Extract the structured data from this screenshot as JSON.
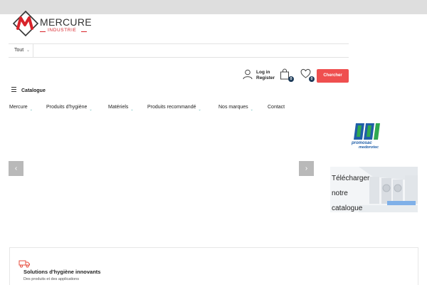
{
  "header": {
    "logo_name": "MERCURE",
    "logo_sub": "INDUSTRIE",
    "account": {
      "login": "Log in",
      "register": "Register"
    },
    "cart_count": "0",
    "wishlist_count": "0",
    "search_button": "Chercher"
  },
  "search": {
    "category": "Tout",
    "value": ""
  },
  "catalogue_label": "Catalogue",
  "nav": {
    "items": [
      {
        "label": "Mercure",
        "has_dropdown": true
      },
      {
        "label": "Produits d'hygiène",
        "has_dropdown": true
      },
      {
        "label": "Matériels",
        "has_dropdown": true
      },
      {
        "label": "Produits recommandé",
        "has_dropdown": true
      },
      {
        "label": "Nos marques",
        "has_dropdown": true
      },
      {
        "label": "Contact",
        "has_dropdown": false
      }
    ]
  },
  "brand_logo": {
    "line1": "promosac",
    "line2": "medprotec"
  },
  "promo": {
    "line1": "Télécharger",
    "line2": "notre",
    "line3": "catalogue"
  },
  "features": [
    {
      "title": "Solutions d'hygiène innovants",
      "desc": "Des produits et des applications"
    }
  ],
  "colors": {
    "accent_red": "#ef4f4f",
    "logo_red": "#d8232a",
    "badge_navy": "#1f3c5a",
    "brand_blue": "#1f5ea8",
    "brand_green": "#2fa84f"
  }
}
